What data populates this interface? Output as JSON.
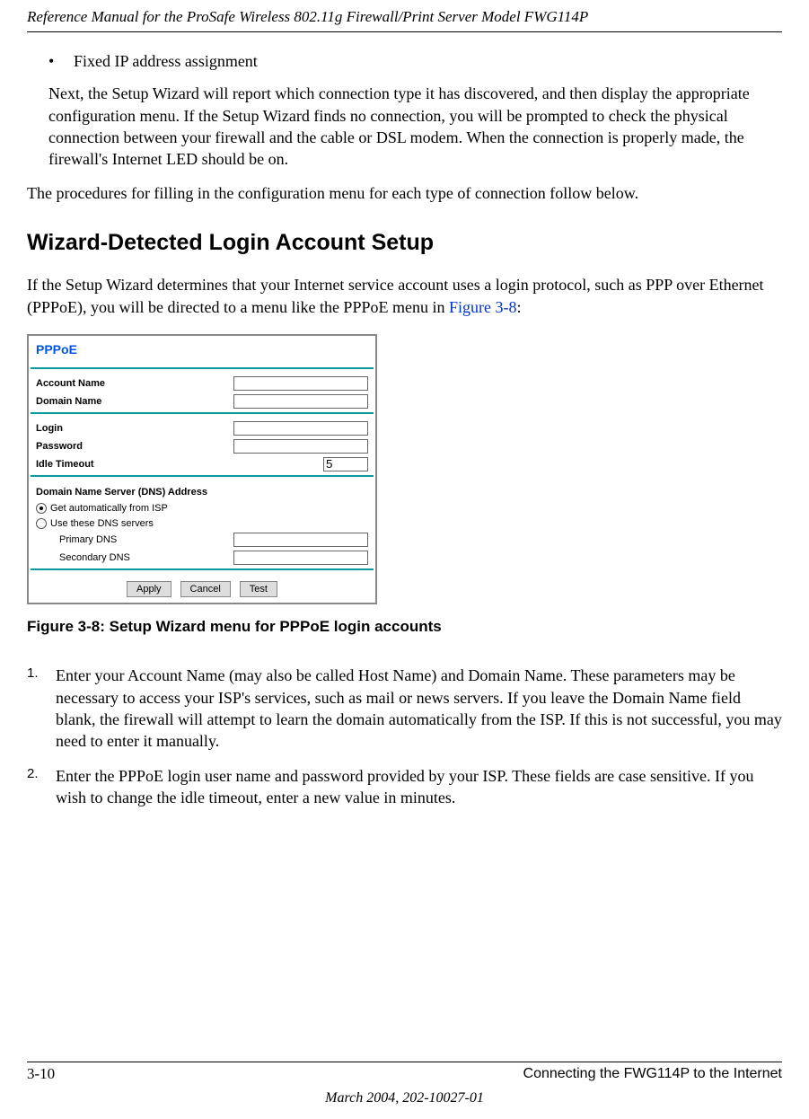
{
  "header": {
    "running_title": "Reference Manual for the ProSafe Wireless 802.11g  Firewall/Print Server Model FWG114P"
  },
  "bullet": {
    "marker": "•",
    "text": "Fixed IP address assignment"
  },
  "para_after_bullet": "Next, the Setup Wizard will report which connection type it has discovered, and then display the appropriate configuration menu. If the Setup Wizard finds no connection, you will be prompted to check the physical connection between your firewall and the cable or DSL modem. When the connection is properly made, the firewall's Internet LED should be on.",
  "para_procedures": "The procedures for filling in the configuration menu for each type of connection follow below.",
  "section_heading": "Wizard-Detected Login Account Setup",
  "intro_para_pre": "If the Setup Wizard determines that your Internet service account uses a login protocol, such as PPP over Ethernet (PPPoE), you will be directed to a menu like the PPPoE menu in ",
  "intro_para_link": "Figure 3-8",
  "intro_para_post": ":",
  "pppoe": {
    "title": "PPPoE",
    "account_name_label": "Account Name",
    "domain_name_label": "Domain Name",
    "login_label": "Login",
    "password_label": "Password",
    "idle_timeout_label": "Idle Timeout",
    "idle_timeout_value": "5",
    "dns_section_label": "Domain Name Server (DNS) Address",
    "dns_auto_label": "Get automatically from ISP",
    "dns_use_label": "Use these DNS servers",
    "primary_dns_label": "Primary DNS",
    "secondary_dns_label": "Secondary DNS",
    "btn_apply": "Apply",
    "btn_cancel": "Cancel",
    "btn_test": "Test"
  },
  "figure_caption": "Figure 3-8: Setup Wizard menu for PPPoE login accounts",
  "steps": {
    "s1_num": "1.",
    "s1_body": "Enter your Account Name (may also be called Host Name) and Domain Name. These parameters may be necessary to access your ISP's services, such as mail or news servers. If you leave the Domain Name field blank, the firewall will attempt to learn the domain automatically from the ISP. If this is not successful, you may need to enter it manually.",
    "s2_num": "2.",
    "s2_body": "Enter the PPPoE login user name and password provided by your ISP. These fields are case sensitive. If you wish to change the idle timeout, enter a new value in minutes."
  },
  "footer": {
    "page_number": "3-10",
    "chapter": "Connecting the FWG114P to the Internet",
    "dateline": "March 2004, 202-10027-01"
  }
}
